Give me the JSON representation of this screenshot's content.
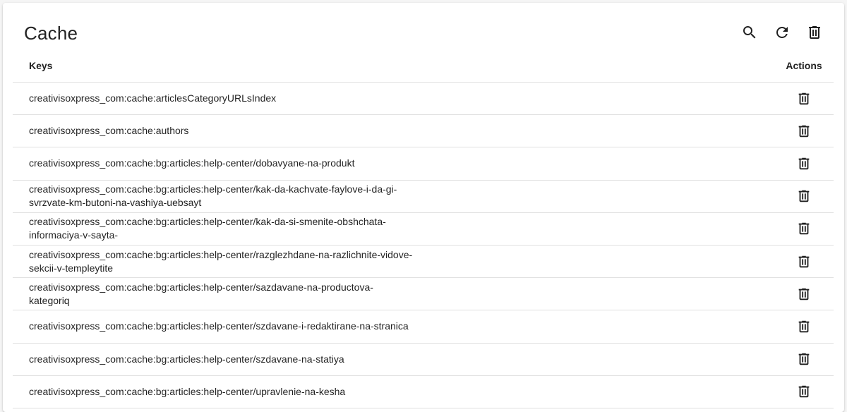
{
  "card": {
    "title": "Cache"
  },
  "toolbar": {
    "search_icon": "search-icon",
    "refresh_icon": "refresh-icon",
    "delete_all_icon": "trash-icon"
  },
  "table": {
    "columns": {
      "keys": "Keys",
      "actions": "Actions"
    },
    "rows": [
      {
        "key": "creativisoxpress_com:cache:articlesCategoryURLsIndex"
      },
      {
        "key": "creativisoxpress_com:cache:authors"
      },
      {
        "key": "creativisoxpress_com:cache:bg:articles:help-center/dobavyane-na-produkt"
      },
      {
        "key": "creativisoxpress_com:cache:bg:articles:help-center/kak-da-kachvate-faylove-i-da-gi-svrzvate-km-butoni-na-vashiya-uebsayt"
      },
      {
        "key": "creativisoxpress_com:cache:bg:articles:help-center/kak-da-si-smenite-obshchata-informaciya-v-sayta-"
      },
      {
        "key": "creativisoxpress_com:cache:bg:articles:help-center/razglezhdane-na-razlichnite-vidove-sekcii-v-templeytite"
      },
      {
        "key": "creativisoxpress_com:cache:bg:articles:help-center/sazdavane-na-productova-kategoriq"
      },
      {
        "key": "creativisoxpress_com:cache:bg:articles:help-center/szdavane-i-redaktirane-na-stranica"
      },
      {
        "key": "creativisoxpress_com:cache:bg:articles:help-center/szdavane-na-statiya"
      },
      {
        "key": "creativisoxpress_com:cache:bg:articles:help-center/upravlenie-na-kesha"
      }
    ]
  }
}
